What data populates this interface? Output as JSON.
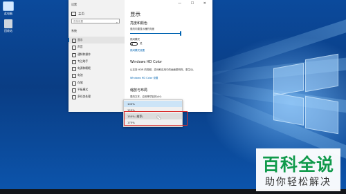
{
  "desktop": {
    "icon1_label": "此电脑",
    "icon2_label": "回收站"
  },
  "window": {
    "title": "设置",
    "controls": "— ☐ ✕"
  },
  "sidebar": {
    "home_label": "主页",
    "search_placeholder": "查找设置",
    "section_label": "系统",
    "items": [
      {
        "label": "显示",
        "active": true
      },
      {
        "label": "声音"
      },
      {
        "label": "通知和操作"
      },
      {
        "label": "专注助手"
      },
      {
        "label": "电源和睡眠"
      },
      {
        "label": "电池"
      },
      {
        "label": "存储"
      },
      {
        "label": "平板模式"
      },
      {
        "label": "多任务处理"
      }
    ]
  },
  "content": {
    "page_title": "显示",
    "brightness_heading": "亮度和颜色",
    "brightness_label": "更改内置显示器的亮度",
    "night_light_label": "夜间模式",
    "night_light_state": "关",
    "night_light_settings_link": "夜间模式设置",
    "hd_color_heading": "Windows HD Color",
    "hd_color_desc": "让支持 HDR 的视频、游戏和应用中的画面更明亮、更生动。",
    "hd_color_link": "Windows HD Color 设置",
    "scale_heading": "缩放与布局",
    "scale_label": "更改文本、应用等项目的大小"
  },
  "dropdown": {
    "options": [
      "100%",
      "125%",
      "150% (推荐)",
      "175%"
    ],
    "selected_index": 0,
    "hover_index": 2
  },
  "watermark": {
    "main": "百科全说",
    "sub": "助你轻松解决"
  }
}
